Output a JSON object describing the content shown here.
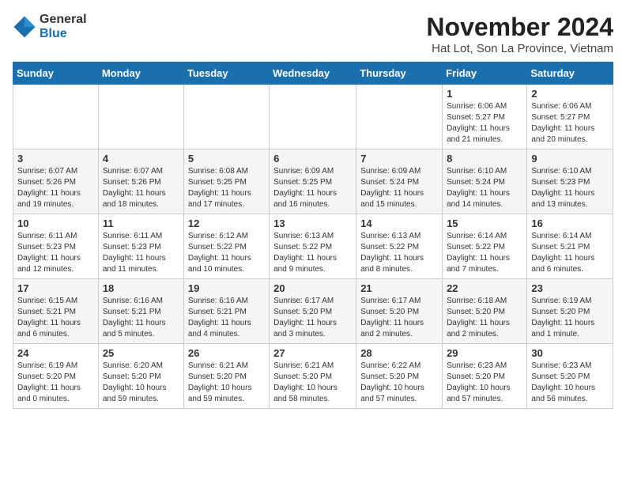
{
  "logo": {
    "general": "General",
    "blue": "Blue"
  },
  "title": "November 2024",
  "subtitle": "Hat Lot, Son La Province, Vietnam",
  "headers": [
    "Sunday",
    "Monday",
    "Tuesday",
    "Wednesday",
    "Thursday",
    "Friday",
    "Saturday"
  ],
  "weeks": [
    [
      {
        "day": "",
        "info": ""
      },
      {
        "day": "",
        "info": ""
      },
      {
        "day": "",
        "info": ""
      },
      {
        "day": "",
        "info": ""
      },
      {
        "day": "",
        "info": ""
      },
      {
        "day": "1",
        "info": "Sunrise: 6:06 AM\nSunset: 5:27 PM\nDaylight: 11 hours and 21 minutes."
      },
      {
        "day": "2",
        "info": "Sunrise: 6:06 AM\nSunset: 5:27 PM\nDaylight: 11 hours and 20 minutes."
      }
    ],
    [
      {
        "day": "3",
        "info": "Sunrise: 6:07 AM\nSunset: 5:26 PM\nDaylight: 11 hours and 19 minutes."
      },
      {
        "day": "4",
        "info": "Sunrise: 6:07 AM\nSunset: 5:26 PM\nDaylight: 11 hours and 18 minutes."
      },
      {
        "day": "5",
        "info": "Sunrise: 6:08 AM\nSunset: 5:25 PM\nDaylight: 11 hours and 17 minutes."
      },
      {
        "day": "6",
        "info": "Sunrise: 6:09 AM\nSunset: 5:25 PM\nDaylight: 11 hours and 16 minutes."
      },
      {
        "day": "7",
        "info": "Sunrise: 6:09 AM\nSunset: 5:24 PM\nDaylight: 11 hours and 15 minutes."
      },
      {
        "day": "8",
        "info": "Sunrise: 6:10 AM\nSunset: 5:24 PM\nDaylight: 11 hours and 14 minutes."
      },
      {
        "day": "9",
        "info": "Sunrise: 6:10 AM\nSunset: 5:23 PM\nDaylight: 11 hours and 13 minutes."
      }
    ],
    [
      {
        "day": "10",
        "info": "Sunrise: 6:11 AM\nSunset: 5:23 PM\nDaylight: 11 hours and 12 minutes."
      },
      {
        "day": "11",
        "info": "Sunrise: 6:11 AM\nSunset: 5:23 PM\nDaylight: 11 hours and 11 minutes."
      },
      {
        "day": "12",
        "info": "Sunrise: 6:12 AM\nSunset: 5:22 PM\nDaylight: 11 hours and 10 minutes."
      },
      {
        "day": "13",
        "info": "Sunrise: 6:13 AM\nSunset: 5:22 PM\nDaylight: 11 hours and 9 minutes."
      },
      {
        "day": "14",
        "info": "Sunrise: 6:13 AM\nSunset: 5:22 PM\nDaylight: 11 hours and 8 minutes."
      },
      {
        "day": "15",
        "info": "Sunrise: 6:14 AM\nSunset: 5:22 PM\nDaylight: 11 hours and 7 minutes."
      },
      {
        "day": "16",
        "info": "Sunrise: 6:14 AM\nSunset: 5:21 PM\nDaylight: 11 hours and 6 minutes."
      }
    ],
    [
      {
        "day": "17",
        "info": "Sunrise: 6:15 AM\nSunset: 5:21 PM\nDaylight: 11 hours and 6 minutes."
      },
      {
        "day": "18",
        "info": "Sunrise: 6:16 AM\nSunset: 5:21 PM\nDaylight: 11 hours and 5 minutes."
      },
      {
        "day": "19",
        "info": "Sunrise: 6:16 AM\nSunset: 5:21 PM\nDaylight: 11 hours and 4 minutes."
      },
      {
        "day": "20",
        "info": "Sunrise: 6:17 AM\nSunset: 5:20 PM\nDaylight: 11 hours and 3 minutes."
      },
      {
        "day": "21",
        "info": "Sunrise: 6:17 AM\nSunset: 5:20 PM\nDaylight: 11 hours and 2 minutes."
      },
      {
        "day": "22",
        "info": "Sunrise: 6:18 AM\nSunset: 5:20 PM\nDaylight: 11 hours and 2 minutes."
      },
      {
        "day": "23",
        "info": "Sunrise: 6:19 AM\nSunset: 5:20 PM\nDaylight: 11 hours and 1 minute."
      }
    ],
    [
      {
        "day": "24",
        "info": "Sunrise: 6:19 AM\nSunset: 5:20 PM\nDaylight: 11 hours and 0 minutes."
      },
      {
        "day": "25",
        "info": "Sunrise: 6:20 AM\nSunset: 5:20 PM\nDaylight: 10 hours and 59 minutes."
      },
      {
        "day": "26",
        "info": "Sunrise: 6:21 AM\nSunset: 5:20 PM\nDaylight: 10 hours and 59 minutes."
      },
      {
        "day": "27",
        "info": "Sunrise: 6:21 AM\nSunset: 5:20 PM\nDaylight: 10 hours and 58 minutes."
      },
      {
        "day": "28",
        "info": "Sunrise: 6:22 AM\nSunset: 5:20 PM\nDaylight: 10 hours and 57 minutes."
      },
      {
        "day": "29",
        "info": "Sunrise: 6:23 AM\nSunset: 5:20 PM\nDaylight: 10 hours and 57 minutes."
      },
      {
        "day": "30",
        "info": "Sunrise: 6:23 AM\nSunset: 5:20 PM\nDaylight: 10 hours and 56 minutes."
      }
    ]
  ]
}
